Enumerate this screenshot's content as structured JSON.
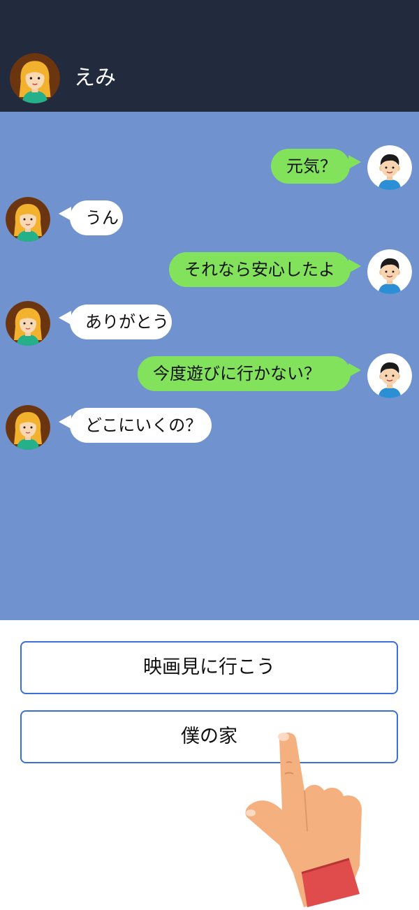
{
  "header": {
    "contact_name": "えみ",
    "avatar_icon": "girl-avatar-icon"
  },
  "messages": [
    {
      "from": "me",
      "text": "元気？"
    },
    {
      "from": "emi",
      "text": "うん"
    },
    {
      "from": "me",
      "text": "それなら安心したよ"
    },
    {
      "from": "emi",
      "text": "ありがとう"
    },
    {
      "from": "me",
      "text": "今度遊びに行かない？"
    },
    {
      "from": "emi",
      "text": "どこにいくの？"
    }
  ],
  "reply_options": [
    {
      "label": "映画見に行こう"
    },
    {
      "label": "僕の家"
    }
  ],
  "colors": {
    "header_bg": "#222a3e",
    "chat_bg": "#7093d0",
    "outgoing_bubble": "#82e25c",
    "incoming_bubble": "#ffffff",
    "option_border": "#3a6fd6"
  },
  "icons": {
    "pointer": "pointing-hand-icon",
    "boy": "boy-avatar-icon",
    "girl": "girl-avatar-icon"
  }
}
